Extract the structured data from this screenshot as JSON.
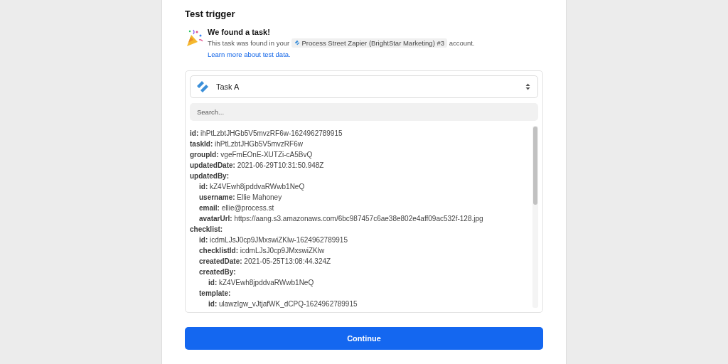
{
  "heading": "Test trigger",
  "notice": {
    "title": "We found a task!",
    "text_before": "This task was found in your",
    "account": "Process Street Zapier (BrightStar Marketing) #3",
    "text_after": "account.",
    "link": "Learn more about test data."
  },
  "task_select": {
    "value": "Task A"
  },
  "search": {
    "placeholder": "Search..."
  },
  "fields": [
    {
      "key": "id:",
      "value": "ihPtLzbtJHGb5V5mvzRF6w-1624962789915"
    },
    {
      "key": "taskId:",
      "value": "ihPtLzbtJHGb5V5mvzRF6w"
    },
    {
      "key": "groupId:",
      "value": "vgeFmEOnE-XUTZi-cA5BvQ"
    },
    {
      "key": "updatedDate:",
      "value": "2021-06-29T10:31:50.948Z"
    },
    {
      "key": "updatedBy:",
      "children": [
        {
          "key": "id:",
          "value": "kZ4VEwh8jpddvaRWwb1NeQ"
        },
        {
          "key": "username:",
          "value": "Ellie Mahoney"
        },
        {
          "key": "email:",
          "value": "ellie@process.st"
        },
        {
          "key": "avatarUrl:",
          "value": "https://aang.s3.amazonaws.com/6bc987457c6ae38e802e4aff09ac532f-128.jpg"
        }
      ]
    },
    {
      "key": "checklist:",
      "children": [
        {
          "key": "id:",
          "value": "icdmLJsJ0cp9JMxswiZKlw-1624962789915"
        },
        {
          "key": "checklistId:",
          "value": "icdmLJsJ0cp9JMxswiZKlw"
        },
        {
          "key": "createdDate:",
          "value": "2021-05-25T13:08:44.324Z"
        },
        {
          "key": "createdBy:",
          "children": [
            {
              "key": "id:",
              "value": "kZ4VEwh8jpddvaRWwb1NeQ"
            }
          ]
        },
        {
          "key": "template:",
          "children": [
            {
              "key": "id:",
              "value": "ulawzIgw_vJtjafWK_dCPQ-1624962789915"
            }
          ]
        }
      ]
    }
  ],
  "continue_button": "Continue"
}
